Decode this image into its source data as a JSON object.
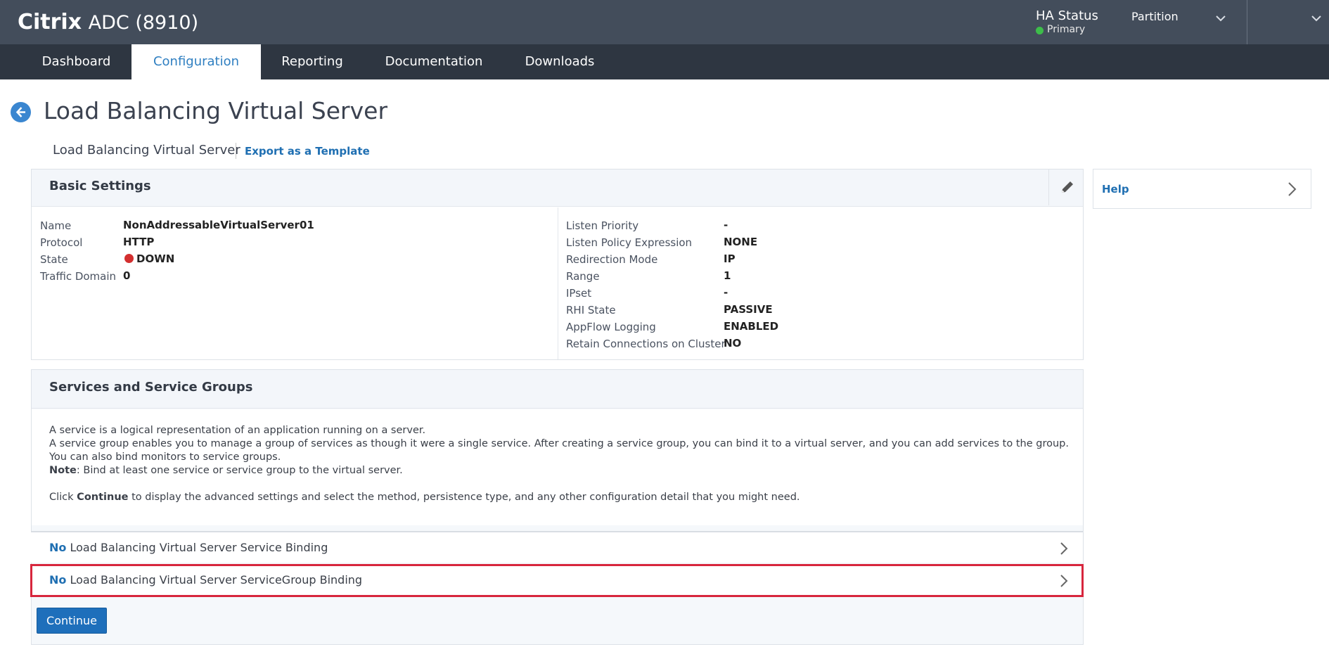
{
  "header": {
    "brand_bold": "Citrix",
    "brand_model": "ADC (8910)",
    "ha_title": "HA Status",
    "ha_state": "Primary",
    "partition_label": "Partition"
  },
  "nav": {
    "tabs": [
      {
        "label": "Dashboard"
      },
      {
        "label": "Configuration"
      },
      {
        "label": "Reporting"
      },
      {
        "label": "Documentation"
      },
      {
        "label": "Downloads"
      }
    ]
  },
  "page": {
    "title": "Load Balancing Virtual Server",
    "breadcrumb": "Load Balancing Virtual Server",
    "export_link": "Export as a Template"
  },
  "basic_settings": {
    "title": "Basic Settings",
    "left": [
      {
        "label": "Name",
        "value": "NonAddressableVirtualServer01"
      },
      {
        "label": "Protocol",
        "value": "HTTP"
      },
      {
        "label": "State",
        "value": "DOWN"
      },
      {
        "label": "Traffic Domain",
        "value": "0"
      }
    ],
    "right": [
      {
        "label": "Listen Priority",
        "value": "-"
      },
      {
        "label": "Listen Policy Expression",
        "value": "NONE"
      },
      {
        "label": "Redirection Mode",
        "value": "IP"
      },
      {
        "label": "Range",
        "value": "1"
      },
      {
        "label": "IPset",
        "value": "-"
      },
      {
        "label": "RHI State",
        "value": "PASSIVE"
      },
      {
        "label": "AppFlow Logging",
        "value": "ENABLED"
      },
      {
        "label": "Retain Connections on Cluster",
        "value": "NO"
      }
    ]
  },
  "services": {
    "title": "Services and Service Groups",
    "line1": "A service is a logical representation of an application running on a server.",
    "line2": "A service group enables you to manage a group of services as though it were a single service. After creating a service group, you can bind it to a virtual server, and you can add services to the group. You can also bind monitors to service groups.",
    "note_label": "Note",
    "note_text": ": Bind at least one service or service group to the virtual server.",
    "click_prefix": "Click ",
    "click_bold": "Continue",
    "click_suffix": " to display the advanced settings and select the method, persistence type, and any other configuration detail that you might need.",
    "bindings": [
      {
        "count": "No",
        "label": " Load Balancing Virtual Server Service Binding"
      },
      {
        "count": "No",
        "label": " Load Balancing Virtual Server ServiceGroup Binding"
      }
    ],
    "continue_label": "Continue"
  },
  "help": {
    "label": "Help"
  },
  "colors": {
    "header_bg": "#434d5b",
    "nav_bg": "#2e3641",
    "accent": "#1f6fb2",
    "status_down": "#d32f2f",
    "status_primary": "#3dbd4a",
    "highlight": "#d7263d"
  }
}
